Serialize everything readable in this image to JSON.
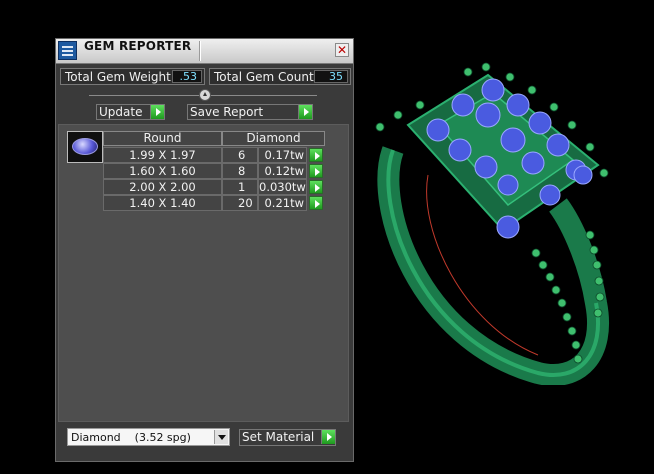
{
  "window": {
    "title": "GEM REPORTER",
    "close_glyph": "✕"
  },
  "stats": {
    "total_weight_label": "Total Gem Weight",
    "total_weight_value": ".53",
    "total_count_label": "Total Gem Count",
    "total_count_value": "35"
  },
  "actions": {
    "update_label": "Update",
    "save_label": "Save Report"
  },
  "table": {
    "columns": [
      "Round",
      "Diamond"
    ],
    "rows": [
      {
        "size": "1.99 X 1.97",
        "count": "6",
        "weight": "0.17tw"
      },
      {
        "size": "1.60 X 1.60",
        "count": "8",
        "weight": "0.12tw"
      },
      {
        "size": "2.00 X 2.00",
        "count": "1",
        "weight": "0.030tw"
      },
      {
        "size": "1.40 X 1.40",
        "count": "20",
        "weight": "0.21tw"
      }
    ]
  },
  "material": {
    "selected": "Diamond    (3.52 spg)",
    "set_label": "Set Material"
  },
  "icons": {
    "app": "gem-reporter-app-icon",
    "go": "green-arrow-icon",
    "gem": "round-gem-icon"
  },
  "colors": {
    "ring_metal": "#1f8a55",
    "gem": "#4a5be0",
    "value_text": "#7fe0ff",
    "go_button": "#2fbf2f"
  }
}
